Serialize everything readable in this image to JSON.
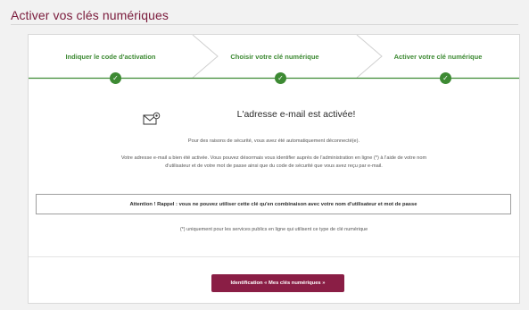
{
  "page": {
    "title": "Activer vos clés numériques"
  },
  "steps": [
    {
      "label": "Indiquer le code d'activation",
      "status": "done"
    },
    {
      "label": "Choisir votre clé numérique",
      "status": "done"
    },
    {
      "label": "Activer votre clé numérique",
      "status": "done"
    }
  ],
  "colors": {
    "brand": "#7a1a3b",
    "button": "#8a1e45",
    "success": "#3d8a33"
  },
  "content": {
    "icon": "envelope-check-icon",
    "headline": "L'adresse e-mail est activée!",
    "logout_notice": "Pour des raisons de sécurité, vous avez été automatiquement déconnecté(e).",
    "activation_text": "Votre adresse e-mail a bien été activée. Vous pouvez désormais vous identifier auprès de l'administration en ligne (*) à l'aide de votre nom d'utilisateur et de votre mot de passe ainsi que du code de sécurité que vous avez reçu par e-mail.",
    "warning": "Attention ! Rappel : vous ne pouvez utiliser cette clé qu'en combinaison avec votre nom d'utilisateur et mot de passe",
    "footnote": "(*) uniquement pour les services publics en ligne qui utilisent ce type de clé numérique"
  },
  "actions": {
    "identification_button": "Identification « Mes clés numériques »"
  }
}
